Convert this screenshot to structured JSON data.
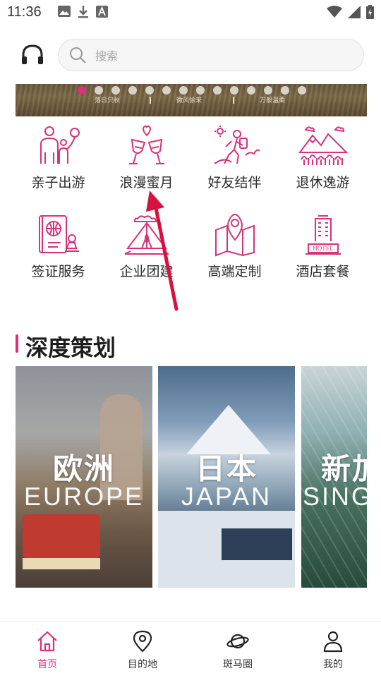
{
  "status_bar": {
    "time": "11:36"
  },
  "search": {
    "placeholder": "搜索"
  },
  "banner": {
    "captions": [
      "落日只秋",
      "微风徐来",
      "万般温柔"
    ],
    "dots_total": 14,
    "active_dot": 0
  },
  "menu": [
    {
      "label": "亲子出游",
      "icon": "family-icon"
    },
    {
      "label": "浪漫蜜月",
      "icon": "wine-glasses-heart-icon"
    },
    {
      "label": "好友结伴",
      "icon": "hiking-friends-icon"
    },
    {
      "label": "退休逸游",
      "icon": "mountains-trees-icon"
    },
    {
      "label": "签证服务",
      "icon": "passport-stamp-icon"
    },
    {
      "label": "企业团建",
      "icon": "tent-campfire-icon"
    },
    {
      "label": "高端定制",
      "icon": "map-pin-icon"
    },
    {
      "label": "酒店套餐",
      "icon": "hotel-icon"
    }
  ],
  "section": {
    "title": "深度策划"
  },
  "cards": [
    {
      "cn": "欧洲",
      "en": "EUROPE"
    },
    {
      "cn": "日本",
      "en": "JAPAN"
    },
    {
      "cn": "新加",
      "en": "SINGA"
    }
  ],
  "nav": [
    {
      "label": "首页",
      "icon": "home-icon",
      "active": true
    },
    {
      "label": "目的地",
      "icon": "location-pin-icon",
      "active": false
    },
    {
      "label": "斑马圈",
      "icon": "planet-icon",
      "active": false
    },
    {
      "label": "我的",
      "icon": "person-icon",
      "active": false
    }
  ],
  "colors": {
    "accent": "#d6337a",
    "text": "#2a2a2a"
  }
}
